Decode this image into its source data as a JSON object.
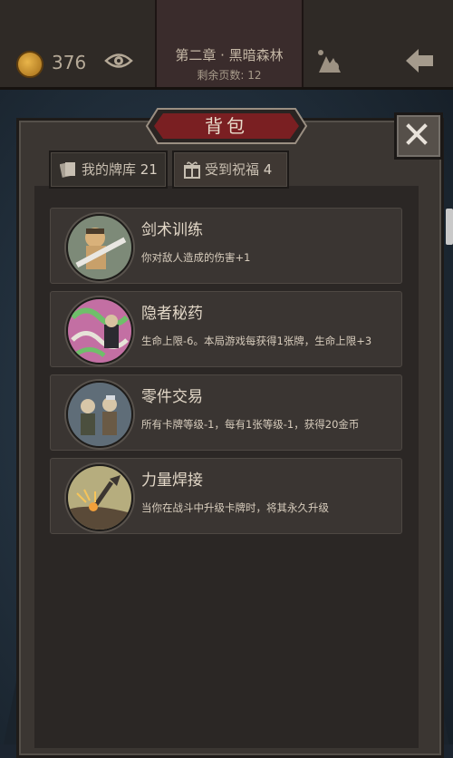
{
  "topbar": {
    "coins": "376",
    "chapter_title": "第二章 · 黑暗森林",
    "chapter_subtitle": "剩余页数: 12",
    "icons": [
      "coin-icon",
      "eye-icon",
      "potion-bag-icon",
      "back-arrow-icon"
    ]
  },
  "panel": {
    "title": "背包",
    "close_icon": "close-icon",
    "tabs": [
      {
        "label": "我的牌库",
        "count": "21",
        "icon": "cards-icon",
        "active": false
      },
      {
        "label": "受到祝福",
        "count": "4",
        "icon": "gift-icon",
        "active": true
      }
    ]
  },
  "blessings": [
    {
      "name": "剑术训练",
      "desc": "你对敌人造成的伤害+1",
      "portrait": "swordsman-portrait"
    },
    {
      "name": "隐者秘药",
      "desc": "生命上限-6。本局游戏每获得1张牌，生命上限+3",
      "portrait": "hermit-potion-portrait"
    },
    {
      "name": "零件交易",
      "desc": "所有卡牌等级-1，每有1张等级-1，获得20金币",
      "portrait": "parts-trade-portrait"
    },
    {
      "name": "力量焊接",
      "desc": "当你在战斗中升级卡牌时，将其永久升级",
      "portrait": "power-weld-portrait"
    }
  ],
  "colors": {
    "panel": "#3b3632",
    "title_plate": "#7a1f22",
    "text": "#e2d7c7"
  }
}
